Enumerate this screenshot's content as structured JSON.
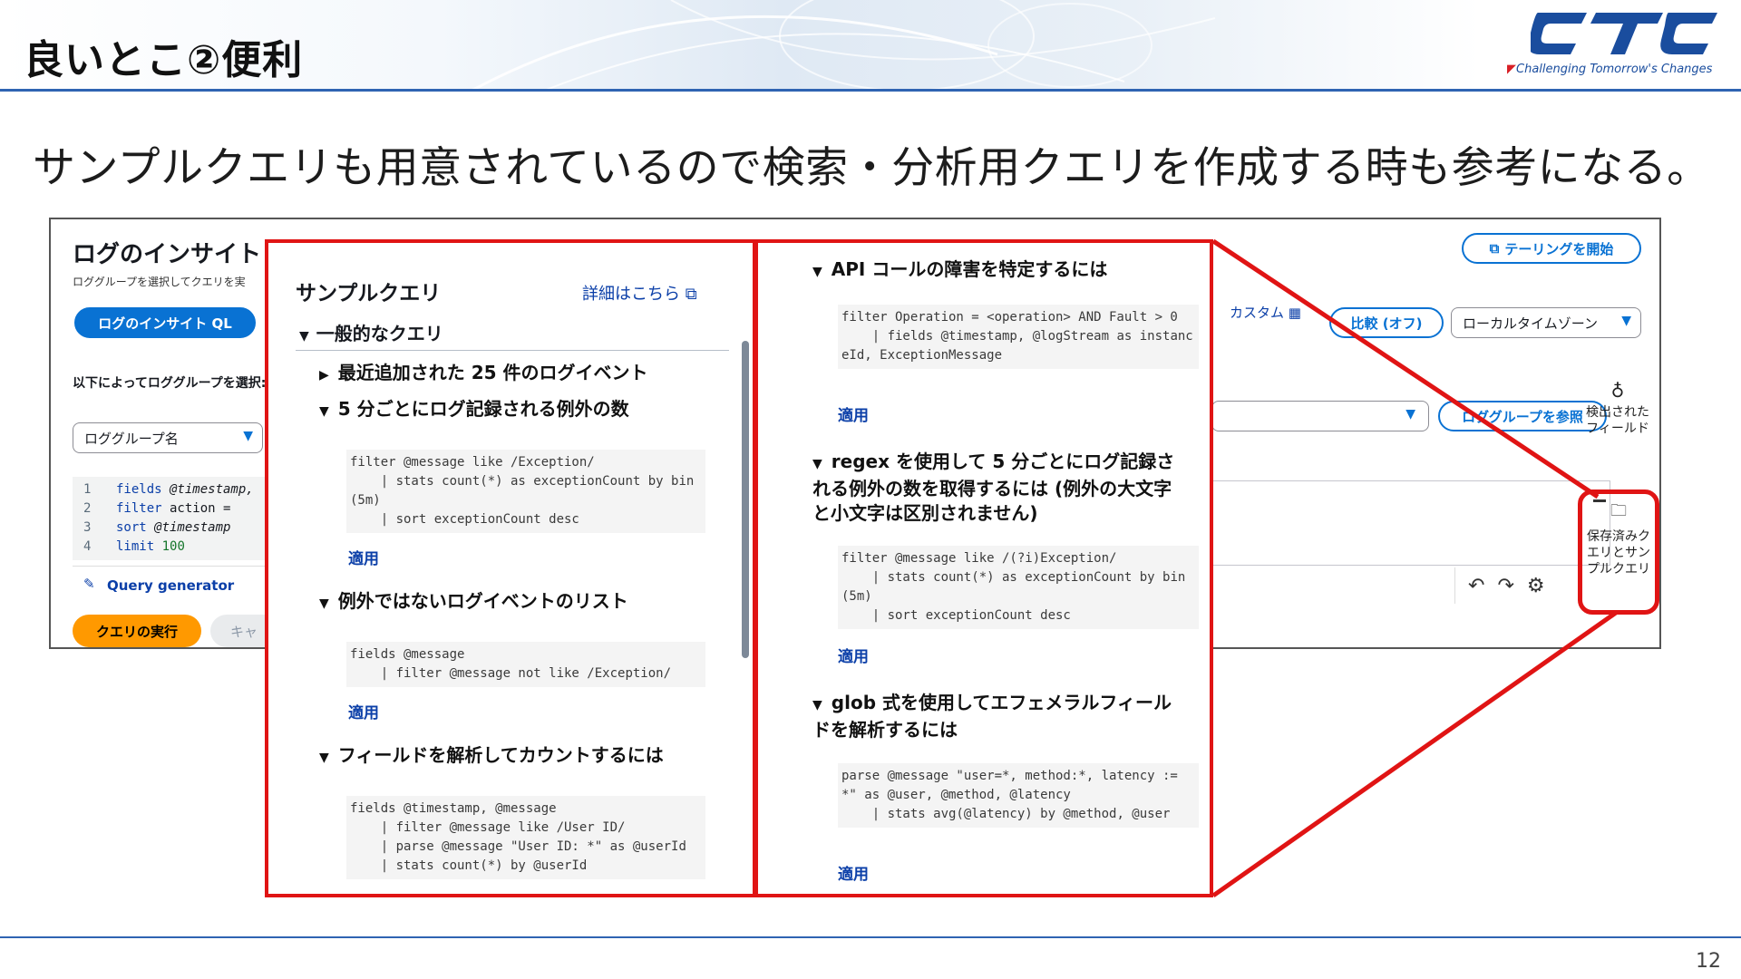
{
  "slide": {
    "title": "良いとこ②便利",
    "subtitle": "サンプルクエリも用意されているので検索・分析用クエリを作成する時も参考になる。",
    "page_number": "12"
  },
  "brand": {
    "logo_text": "CTC",
    "tagline": "Challenging Tomorrow's Changes",
    "logo_color": "#1a4d9e",
    "accent_red": "#e01414"
  },
  "console": {
    "title": "ログのインサイト",
    "description": "ロググループを選択してクエリを実",
    "ql_tab": "ログのインサイト QL",
    "select_label": "以下によってロググループを選択:",
    "log_group_select": "ロググループ名",
    "editor_lines": [
      {
        "num": "1",
        "kw": "fields",
        "rest": " @timestamp,"
      },
      {
        "num": "2",
        "kw": "filter",
        "rest": " action ="
      },
      {
        "num": "3",
        "kw": "sort",
        "rest": " @timestamp"
      },
      {
        "num": "4",
        "kw": "limit",
        "rest": " 100"
      }
    ],
    "query_generator": "Query generator",
    "run_button": "クエリの実行",
    "cancel_button": "キャ",
    "tail_button": "テーリングを開始",
    "custom": "カスタム",
    "compare_button": "比較 (オフ)",
    "timezone_select": "ローカルタイムゾーン",
    "browse_button": "ロググループを参照",
    "rail_discovered_fields": "検出されたフィールド",
    "rail_saved_queries": "保存済みクエリとサンプルクエリ"
  },
  "sample_panel": {
    "title": "サンプルクエリ",
    "learn_more": "詳細はこちら",
    "group": "一般的なクエリ",
    "collapsed_item": "最近追加された 25 件のログイベント",
    "apply_label": "適用",
    "left_queries": [
      {
        "heading": "5 分ごとにログ記録される例外の数",
        "code": "filter @message like /Exception/\n    | stats count(*) as exceptionCount by bin(5m)\n    | sort exceptionCount desc"
      },
      {
        "heading": "例外ではないログイベントのリスト",
        "code": "fields @message\n    | filter @message not like /Exception/"
      },
      {
        "heading": "フィールドを解析してカウントするには",
        "code": "fields @timestamp, @message\n    | filter @message like /User ID/\n    | parse @message \"User ID: *\" as @userId\n    | stats count(*) by @userId"
      }
    ],
    "right_queries": [
      {
        "heading": "API コールの障害を特定するには",
        "code": "filter Operation = <operation> AND Fault > 0\n    | fields @timestamp, @logStream as instanceId, ExceptionMessage"
      },
      {
        "heading": "regex を使用して 5 分ごとにログ記録される例外の数を取得するには (例外の大文字と小文字は区別されません)",
        "code": "filter @message like /(?i)Exception/\n    | stats count(*) as exceptionCount by bin(5m)\n    | sort exceptionCount desc"
      },
      {
        "heading": "glob 式を使用してエフェメラルフィールドを解析するには",
        "code": "parse @message \"user=*, method:*, latency := *\" as @user, @method, @latency\n    | stats avg(@latency) by @method, @user"
      }
    ]
  }
}
